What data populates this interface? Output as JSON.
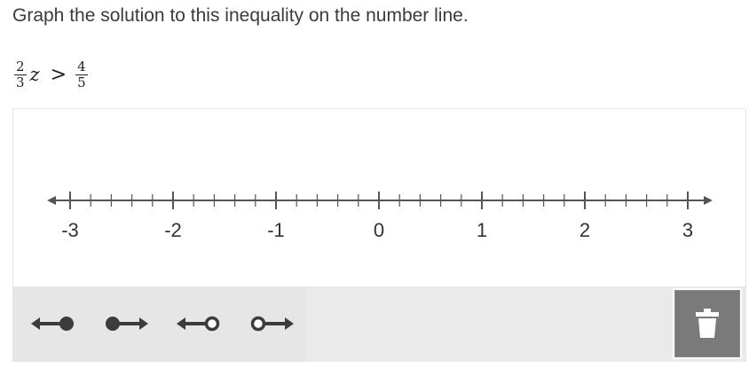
{
  "prompt": "Graph the solution to this inequality on the number line.",
  "equation": {
    "coef_num": "2",
    "coef_den": "3",
    "variable": "z",
    "operator": ">",
    "rhs_num": "4",
    "rhs_den": "5"
  },
  "number_line": {
    "min": -3,
    "max": 3,
    "major_step": 1,
    "minor_step": 0.2,
    "labels": [
      "-3",
      "-2",
      "-1",
      "0",
      "1",
      "2",
      "3"
    ]
  },
  "tools": [
    {
      "name": "closed-left-ray",
      "icon": "closed-dot-left-arrow"
    },
    {
      "name": "closed-right-ray",
      "icon": "closed-dot-right-arrow"
    },
    {
      "name": "open-left-ray",
      "icon": "open-dot-left-arrow"
    },
    {
      "name": "open-right-ray",
      "icon": "open-dot-right-arrow"
    }
  ],
  "trash": {
    "icon": "trash-icon"
  },
  "colors": {
    "line": "#555555",
    "tool_icon": "#3c3c3c",
    "toolbar_bg": "#eaeaea",
    "trash_bg": "#7a7a7a"
  }
}
